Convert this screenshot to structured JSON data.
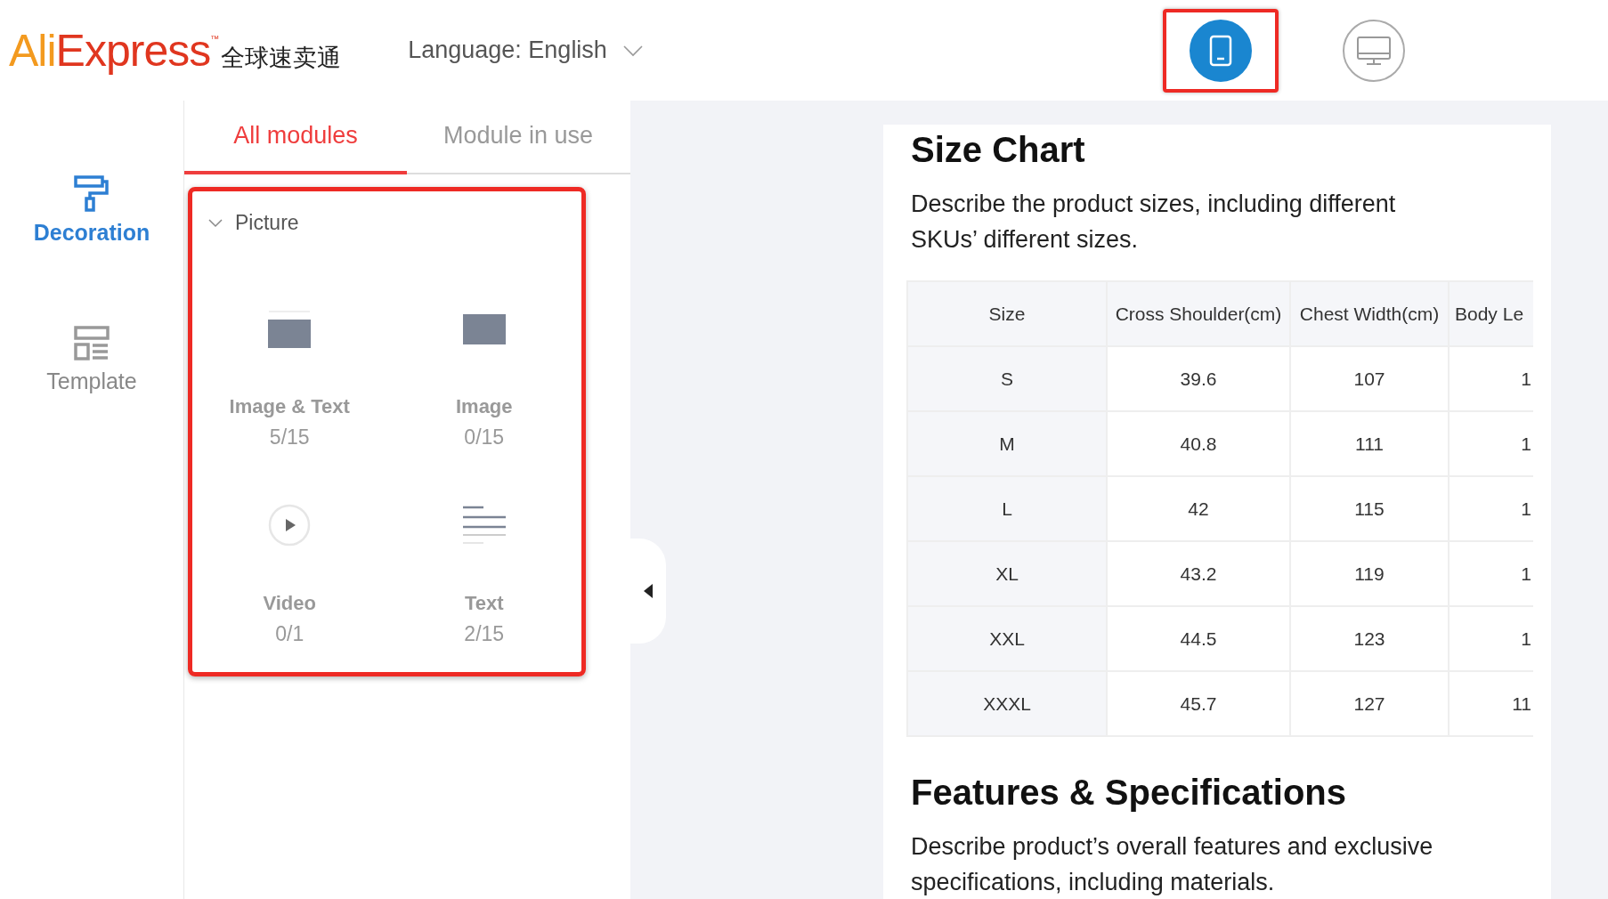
{
  "header": {
    "logo": {
      "brand": "AliExpress",
      "trademark": "™",
      "chinese": "全球速卖通"
    },
    "language": {
      "label": "Language:",
      "value": "English"
    },
    "view_buttons": [
      {
        "kind": "mobile",
        "selected": true,
        "highlighted": true
      },
      {
        "kind": "desktop",
        "selected": false,
        "highlighted": false
      }
    ]
  },
  "sidebar": {
    "items": [
      {
        "kind": "decoration",
        "label": "Decoration",
        "selected": true
      },
      {
        "kind": "template",
        "label": "Template",
        "selected": false
      }
    ]
  },
  "tabs": [
    {
      "label": "All modules",
      "selected": true
    },
    {
      "label": "Module in use",
      "selected": false
    }
  ],
  "module_group": {
    "title": "Picture",
    "expanded": true,
    "highlighted": true,
    "modules": [
      {
        "kind": "image-text",
        "name": "Image & Text",
        "count": "5/15"
      },
      {
        "kind": "image",
        "name": "Image",
        "count": "0/15"
      },
      {
        "kind": "video",
        "name": "Video",
        "count": "0/1"
      },
      {
        "kind": "text",
        "name": "Text",
        "count": "2/15"
      }
    ]
  },
  "preview": {
    "sections": [
      {
        "title": "Size Chart",
        "description": "Describe the product sizes, including different SKUs’ different sizes.",
        "table": {
          "columns": [
            "Size",
            "Cross Shoulder(cm)",
            "Chest Width(cm)",
            "Body Le"
          ],
          "rows": [
            [
              "S",
              "39.6",
              "107",
              "1"
            ],
            [
              "M",
              "40.8",
              "111",
              "1"
            ],
            [
              "L",
              "42",
              "115",
              "1"
            ],
            [
              "XL",
              "43.2",
              "119",
              "1"
            ],
            [
              "XXL",
              "44.5",
              "123",
              "1"
            ],
            [
              "XXXL",
              "45.7",
              "127",
              "11"
            ]
          ]
        }
      },
      {
        "title": "Features & Specifications",
        "description": "Describe product’s overall features and exclusive specifications, including materials."
      }
    ]
  }
}
